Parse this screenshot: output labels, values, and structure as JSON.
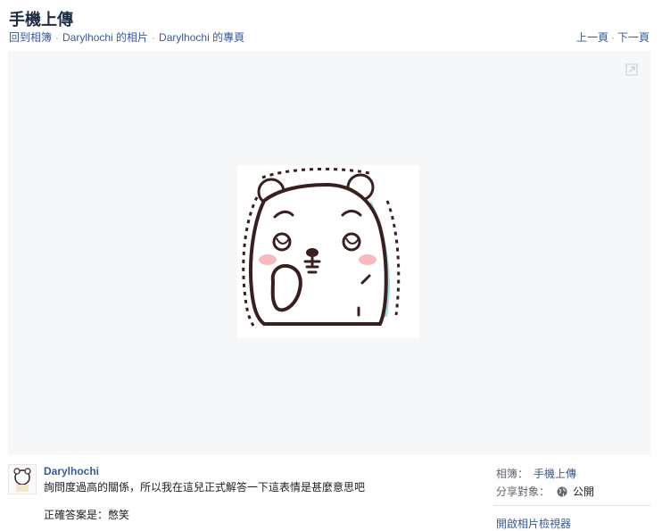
{
  "header": {
    "title": "手機上傳",
    "breadcrumbs": [
      {
        "label": "回到相簿"
      },
      {
        "label": "Darylhochi 的相片"
      },
      {
        "label": "Darylhochi 的專頁"
      }
    ],
    "pager": {
      "prev": "上一頁",
      "next": "下一頁"
    }
  },
  "post": {
    "author": "Darylhochi",
    "description_line1": "詢問度過高的關係，所以我在這兒正式解答一下這表情是甚麼意思吧",
    "description_line2": "正確答案是：憋笑"
  },
  "sidebar": {
    "album_label": "相簿：",
    "album_value": "手機上傳",
    "share_label": "分享對象：",
    "share_value": "公開",
    "viewer_link": "開啟相片檢視器"
  },
  "icons": {
    "fullscreen": "expand-icon",
    "privacy": "globe-icon"
  },
  "colors": {
    "link": "#3b5998",
    "stage_bg": "#f6f7f9",
    "bear_outline": "#3a1f1f",
    "bear_shadow": "#a8dde6",
    "blush": "#f7a8b0"
  }
}
